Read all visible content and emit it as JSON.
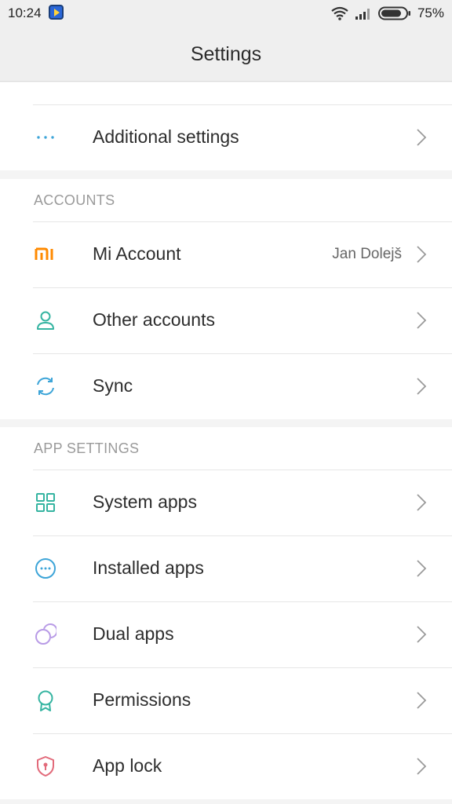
{
  "status": {
    "time": "10:24",
    "battery": "75%",
    "icons": [
      "app-notification-icon",
      "wifi-icon",
      "signal-icon",
      "battery-icon"
    ]
  },
  "header": {
    "title": "Settings"
  },
  "top_group": {
    "partial_item_label": "",
    "items": [
      {
        "icon": "more-dots-icon",
        "label": "Additional settings"
      }
    ]
  },
  "accounts": {
    "header": "ACCOUNTS",
    "items": [
      {
        "icon": "mi-logo-icon",
        "label": "Mi Account",
        "value": "Jan Dolejš"
      },
      {
        "icon": "person-icon",
        "label": "Other accounts"
      },
      {
        "icon": "sync-icon",
        "label": "Sync"
      }
    ]
  },
  "app_settings": {
    "header": "APP SETTINGS",
    "items": [
      {
        "icon": "grid-icon",
        "label": "System apps"
      },
      {
        "icon": "dots-circle-icon",
        "label": "Installed apps"
      },
      {
        "icon": "dual-circles-icon",
        "label": "Dual apps"
      },
      {
        "icon": "badge-icon",
        "label": "Permissions"
      },
      {
        "icon": "shield-lock-icon",
        "label": "App lock"
      }
    ]
  },
  "colors": {
    "mi_orange": "#ff8a00",
    "teal": "#35b4a1",
    "blue": "#3ea5d8",
    "purple": "#b89be6",
    "red": "#e26a7a"
  }
}
